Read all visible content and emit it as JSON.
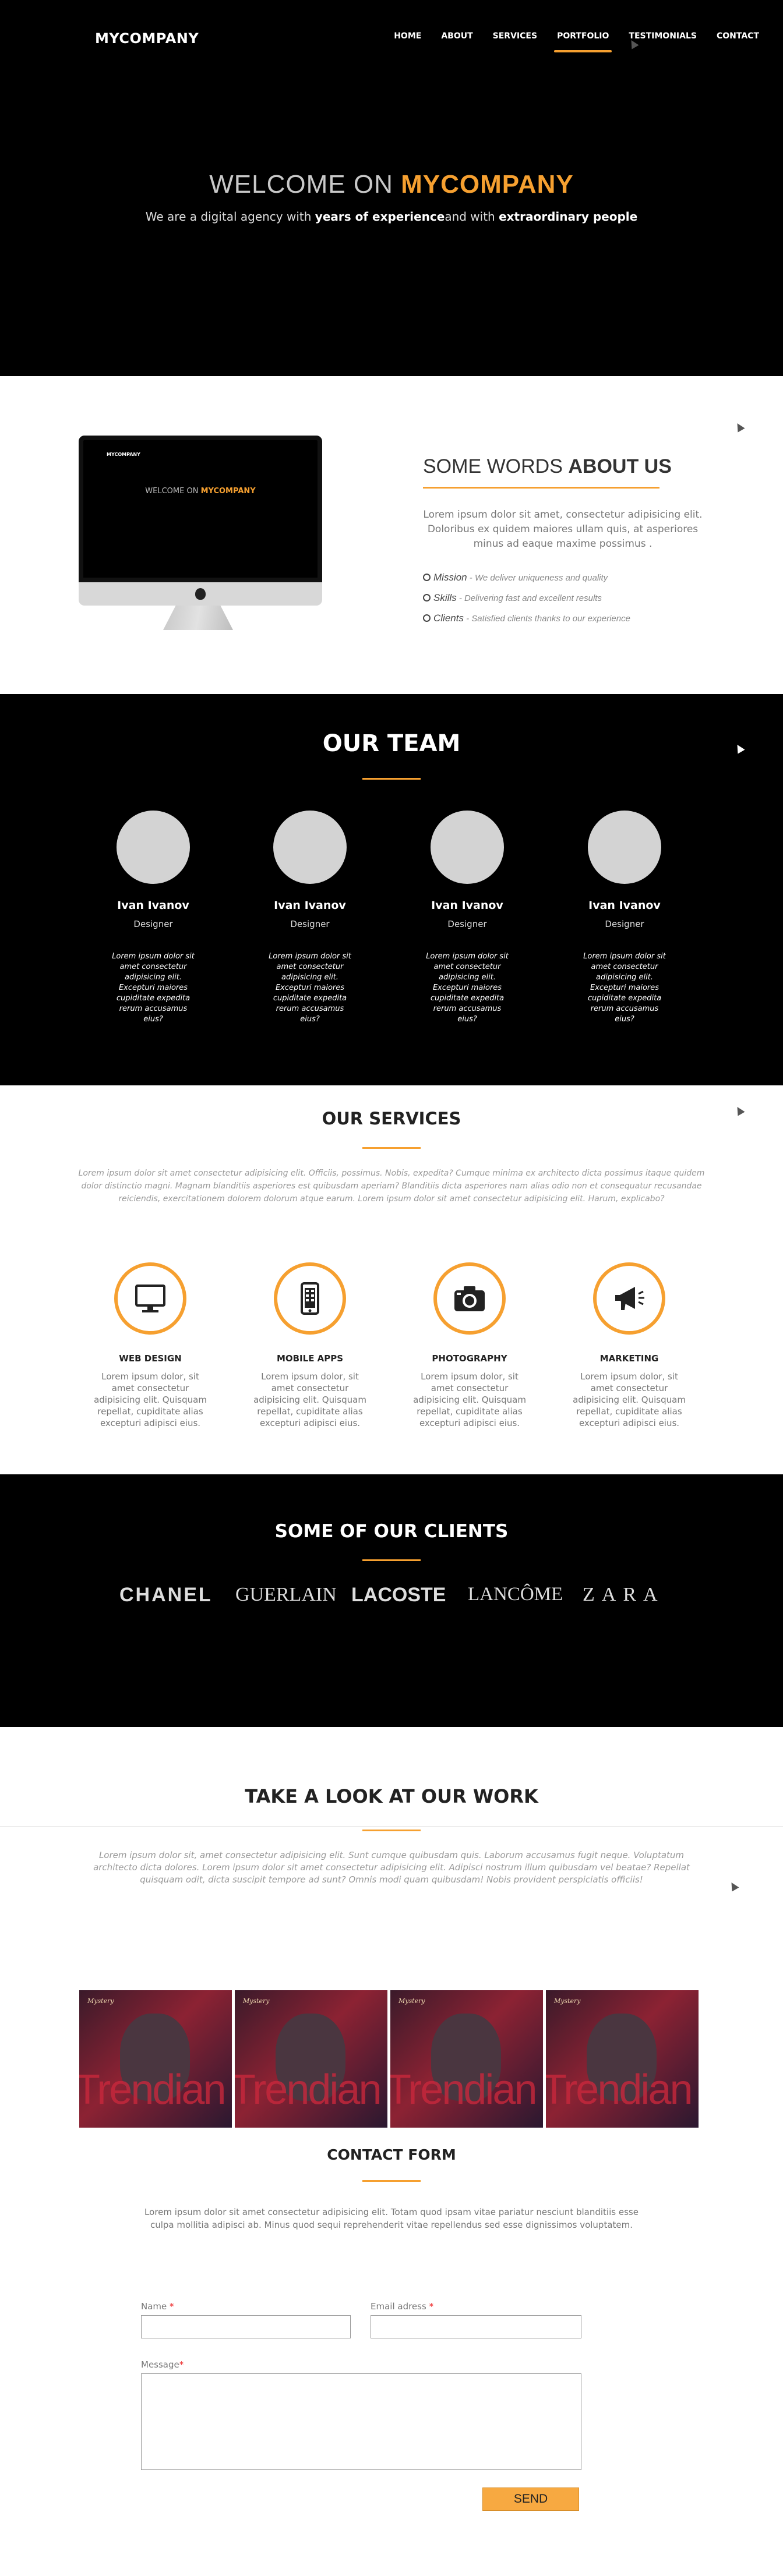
{
  "nav": {
    "brand": "MYCOMPANY",
    "items": [
      {
        "label": "HOME"
      },
      {
        "label": "ABOUT"
      },
      {
        "label": "SERVICES"
      },
      {
        "label": "PORTFOLIO",
        "active": true
      },
      {
        "label": "TESTIMONIALS"
      },
      {
        "label": "CONTACT"
      }
    ]
  },
  "hero": {
    "title_prefix": "WELCOME ON",
    "title_brand": "MYCOMPANY",
    "sub_1": "We are a digital agency with",
    "sub_bold_1": "years of experience",
    "sub_2": "and with",
    "sub_bold_2": "extraordinary people"
  },
  "about": {
    "title_prefix": "SOME WORDS",
    "title_bold": "ABOUT US",
    "text": "Lorem ipsum dolor sit amet, consectetur adipisicing elit. Doloribus ex quidem maiores ullam quis, at asperiores minus ad eaque maxime possimus .",
    "list": [
      {
        "term": "Mission",
        "desc": "- We deliver uniqueness and quality"
      },
      {
        "term": "Skills",
        "desc": "- Delivering fast and excellent results"
      },
      {
        "term": "Clients",
        "desc": "- Satisfied clients thanks to our experience"
      }
    ],
    "mock_title": "MYCOMPANY"
  },
  "team": {
    "title": "OUR TEAM",
    "members": [
      {
        "name": "Ivan Ivanov",
        "role": "Designer",
        "bio": "Lorem ipsum dolor sit amet consectetur adipisicing elit. Excepturi maiores cupiditate expedita rerum accusamus eius?"
      },
      {
        "name": "Ivan Ivanov",
        "role": "Designer",
        "bio": "Lorem ipsum dolor sit amet consectetur adipisicing elit. Excepturi maiores cupiditate expedita rerum accusamus eius?"
      },
      {
        "name": "Ivan Ivanov",
        "role": "Designer",
        "bio": "Lorem ipsum dolor sit amet consectetur adipisicing elit. Excepturi maiores cupiditate expedita rerum accusamus eius?"
      },
      {
        "name": "Ivan Ivanov",
        "role": "Designer",
        "bio": "Lorem ipsum dolor sit amet consectetur adipisicing elit. Excepturi maiores cupiditate expedita rerum accusamus eius?"
      }
    ]
  },
  "services": {
    "title": "OUR SERVICES",
    "intro": "Lorem ipsum dolor sit amet consectetur adipisicing elit. Officiis, possimus. Nobis, expedita? Cumque minima ex architecto dicta possimus itaque quidem dolor distinctio magni. Magnam blanditiis asperiores est quibusdam aperiam? Blanditiis dicta asperiores nam alias odio non et consequatur recusandae reiciendis, exercitationem dolorem dolorum atque earum. Lorem ipsum dolor sit amet consectetur adipisicing elit. Harum, explicabo?",
    "items": [
      {
        "icon": "monitor-icon",
        "title": "WEB DESIGN",
        "desc": "Lorem ipsum dolor, sit amet consectetur adipisicing elit. Quisquam repellat, cupiditate alias excepturi adipisci eius."
      },
      {
        "icon": "phone-icon",
        "title": "MOBILE APPS",
        "desc": "Lorem ipsum dolor, sit amet consectetur adipisicing elit. Quisquam repellat, cupiditate alias excepturi adipisci eius."
      },
      {
        "icon": "camera-icon",
        "title": "PHOTOGRAPHY",
        "desc": "Lorem ipsum dolor, sit amet consectetur adipisicing elit. Quisquam repellat, cupiditate alias excepturi adipisci eius."
      },
      {
        "icon": "megaphone-icon",
        "title": "MARKETING",
        "desc": "Lorem ipsum dolor, sit amet consectetur adipisicing elit. Quisquam repellat, cupiditate alias excepturi adipisci eius."
      }
    ]
  },
  "clients": {
    "title": "SOME OF OUR CLIENTS",
    "logos": [
      "CHANEL",
      "GUERLAIN",
      "LACOSTE",
      "LANCÔME",
      "ZARA"
    ]
  },
  "work": {
    "title": "TAKE A LOOK AT OUR WORK",
    "intro": "Lorem ipsum dolor sit, amet consectetur adipisicing elit. Sunt cumque quibusdam quis. Laborum accusamus fugit neque. Voluptatum architecto dicta dolores. Lorem ipsum dolor sit amet consectetur adipisicing elit. Adipisci nostrum illum quibusdam vel beatae? Repellat quisquam odit, dicta suscipit tempore ad sunt? Omnis modi quam quibusdam! Nobis provident perspiciatis officiis!",
    "thumbs": [
      {
        "tag": "Mystery",
        "word": "Trendian"
      },
      {
        "tag": "Mystery",
        "word": "Trendian"
      },
      {
        "tag": "Mystery",
        "word": "Trendian"
      },
      {
        "tag": "Mystery",
        "word": "Trendian"
      }
    ]
  },
  "contact": {
    "title": "CONTACT FORM",
    "intro": "Lorem ipsum dolor sit amet consectetur adipisicing elit. Totam quod ipsam vitae pariatur nesciunt blanditiis esse culpa mollitia adipisci ab. Minus quod sequi reprehenderit vitae repellendus sed esse dignissimos voluptatem.",
    "name_label": "Name",
    "email_label": "Email adress",
    "message_label": "Message",
    "required_mark": "*",
    "send_label": "SEND"
  },
  "colors": {
    "accent": "#f6a030",
    "dark": "#000000"
  }
}
